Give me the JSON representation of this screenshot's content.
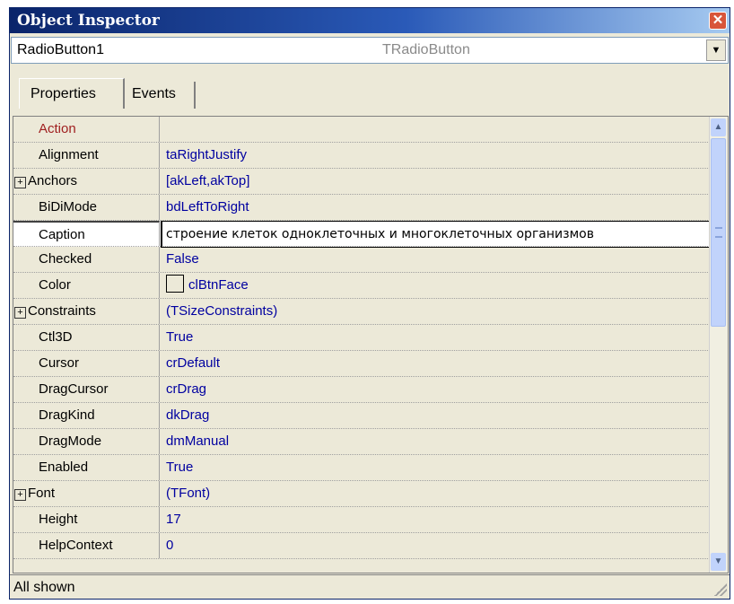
{
  "window": {
    "title": "Object Inspector",
    "close_symbol": "✕"
  },
  "object_selector": {
    "name": "RadioButton1",
    "type": "TRadioButton",
    "dropdown_symbol": "▼"
  },
  "tabs": [
    {
      "label": "Properties",
      "active": true
    },
    {
      "label": "Events",
      "active": false
    }
  ],
  "properties": [
    {
      "name": "Action",
      "value": "",
      "expandable": false
    },
    {
      "name": "Alignment",
      "value": "taRightJustify",
      "expandable": false
    },
    {
      "name": "Anchors",
      "value": "[akLeft,akTop]",
      "expandable": true
    },
    {
      "name": "BiDiMode",
      "value": "bdLeftToRight",
      "expandable": false
    },
    {
      "name": "Caption",
      "value": "строение клеток одноклеточных  и многоклеточных организмов",
      "expandable": false,
      "selected": true
    },
    {
      "name": "Checked",
      "value": "False",
      "expandable": false
    },
    {
      "name": "Color",
      "value": "clBtnFace",
      "expandable": false,
      "swatch": "#ece9d8"
    },
    {
      "name": "Constraints",
      "value": "(TSizeConstraints)",
      "expandable": true
    },
    {
      "name": "Ctl3D",
      "value": "True",
      "expandable": false
    },
    {
      "name": "Cursor",
      "value": "crDefault",
      "expandable": false
    },
    {
      "name": "DragCursor",
      "value": "crDrag",
      "expandable": false
    },
    {
      "name": "DragKind",
      "value": "dkDrag",
      "expandable": false
    },
    {
      "name": "DragMode",
      "value": "dmManual",
      "expandable": false
    },
    {
      "name": "Enabled",
      "value": "True",
      "expandable": false
    },
    {
      "name": "Font",
      "value": "(TFont)",
      "expandable": true
    },
    {
      "name": "Height",
      "value": "17",
      "expandable": false
    },
    {
      "name": "HelpContext",
      "value": "0",
      "expandable": false
    }
  ],
  "expander_symbol": "+",
  "scrollbar": {
    "up_symbol": "▲",
    "down_symbol": "▼"
  },
  "status": {
    "text": "All shown"
  },
  "colors": {
    "title_start": "#0a246a",
    "title_end": "#a6caf0",
    "value_text": "#0000a0",
    "action_text": "#a02020",
    "face": "#ece9d8"
  }
}
